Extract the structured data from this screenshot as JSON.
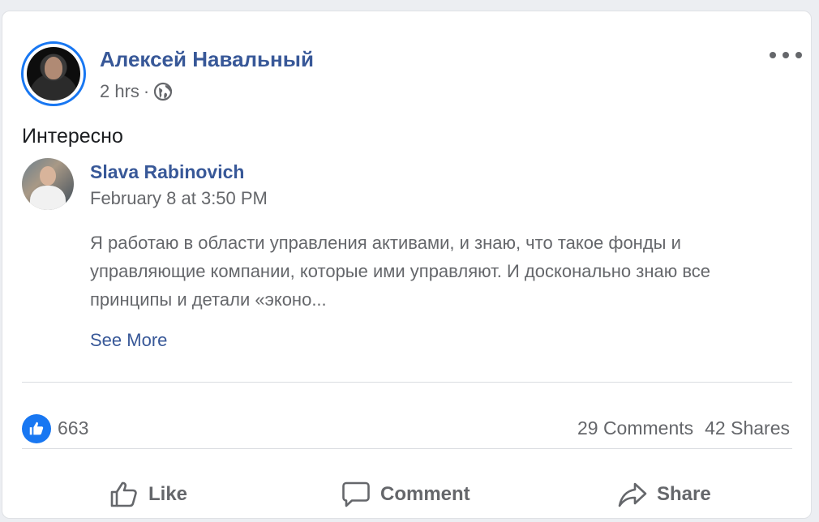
{
  "post": {
    "author": "Алексей Навальный",
    "time": "2 hrs",
    "separator": "·",
    "privacy_icon": "globe-icon",
    "text": "Интересно",
    "more_icon": "ellipsis-icon"
  },
  "shared": {
    "author": "Slava Rabinovich",
    "date": "February 8 at 3:50 PM",
    "body": "Я работаю в области управления активами, и знаю, что такое фонды и управляющие компании, которые ими управляют. И досконально знаю все принципы и детали «эконо...",
    "see_more": "See More"
  },
  "stats": {
    "likes": "663",
    "comments": "29 Comments",
    "shares": "42 Shares"
  },
  "actions": {
    "like": "Like",
    "comment": "Comment",
    "share": "Share"
  },
  "colors": {
    "link_blue": "#385898",
    "accent_blue": "#1877f2",
    "secondary_text": "#65676b"
  }
}
